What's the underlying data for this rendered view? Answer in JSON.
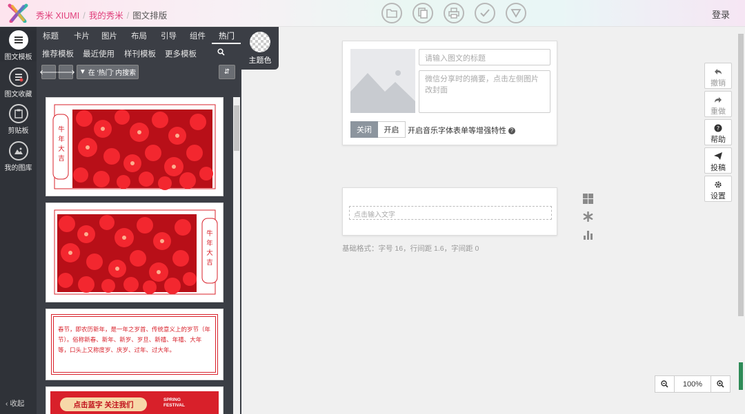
{
  "header": {
    "brand": "秀米 XIUMI",
    "breadcrumb": [
      "我的秀米",
      "图文排版"
    ],
    "login": "登录"
  },
  "rail": {
    "items": [
      {
        "label": "图文模板",
        "icon": "list-icon",
        "active": true
      },
      {
        "label": "图文收藏",
        "icon": "favorites-icon"
      },
      {
        "label": "剪贴板",
        "icon": "clipboard-icon"
      },
      {
        "label": "我的图库",
        "icon": "gallery-icon"
      }
    ],
    "collapse": "收起"
  },
  "panel": {
    "tabs_row1": [
      "标题",
      "卡片",
      "图片",
      "布局",
      "引导",
      "组件",
      "热门"
    ],
    "tabs_row2": [
      "推荐模板",
      "最近使用",
      "样刊模板",
      "更多模板"
    ],
    "search_filter_label": "在 '热门' 内搜索",
    "templates": {
      "card1_text": [
        "牛",
        "年",
        "大",
        "吉"
      ],
      "card2_text": [
        "牛",
        "年",
        "大",
        "吉"
      ],
      "card3_text": "春节，即农历新年，是一年之岁首、传统意义上的岁节（年节）。俗称新春、新年、新岁、岁旦、新禧、年禧、大年等，口头上又称度岁、庆岁、过年、过大年。",
      "card4_button": "点击蓝字 关注我们",
      "card4_tag_line1": "SPRING",
      "card4_tag_line2": "FESTIVAL"
    }
  },
  "theme": {
    "label": "主题色"
  },
  "editor": {
    "title_placeholder": "请输入图文的标题",
    "digest_placeholder": "微信分享时的摘要，点击左侧图片改封面",
    "toggle_off": "关闭",
    "toggle_on": "开启",
    "music_label": "开启音乐字体表单等增强特性",
    "text_placeholder": "点击输入文字",
    "base_format": "基础格式：字号 16，行间距 1.6，字间距 0"
  },
  "right_tools": [
    {
      "label": "撤销",
      "icon": "undo-icon"
    },
    {
      "label": "重做",
      "icon": "redo-icon"
    },
    {
      "label": "帮助",
      "icon": "help-icon"
    },
    {
      "label": "投稿",
      "icon": "send-icon"
    },
    {
      "label": "设置",
      "icon": "gear-icon"
    }
  ],
  "zoom": {
    "value": "100%"
  },
  "colors": {
    "brand_pink": "#e03e7a",
    "panel_dark": "#3b3e45",
    "rail_dark": "#2f3238",
    "festive_red": "#d8202a"
  }
}
